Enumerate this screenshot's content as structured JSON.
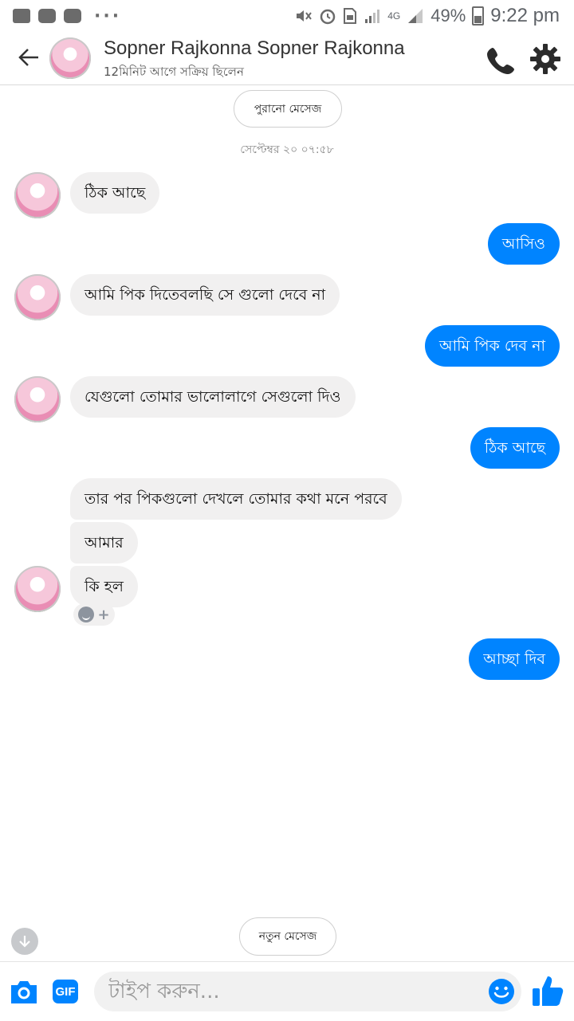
{
  "status_bar": {
    "battery": "49%",
    "time": "9:22 pm",
    "network": "4G",
    "dots": "···"
  },
  "header": {
    "contact_name": "Sopner Rajkonna Sopner Rajkonna",
    "active_status": "12মিনিট আগে সক্রিয় ছিলেন"
  },
  "older_messages_label": "পুরানো মেসেজ",
  "timestamp": "সেপ্টেম্বর ২০ ০৭:৫৮",
  "messages": [
    {
      "dir": "in",
      "text": "ঠিক আছে"
    },
    {
      "dir": "out",
      "text": "আসিও"
    },
    {
      "dir": "in",
      "text": "আমি পিক দিতেবলছি সে গুলো দেবে না"
    },
    {
      "dir": "out",
      "text": "আমি পিক দেব না"
    },
    {
      "dir": "in",
      "text": "যেগুলো তোমার ভালোলাগে সেগুলো দিও"
    },
    {
      "dir": "out",
      "text": "ঠিক আছে"
    },
    {
      "dir": "in",
      "text": "তার পর পিকগুলো দেখলে তোমার কথা মনে পরবে"
    },
    {
      "dir": "in",
      "text": "আমার"
    },
    {
      "dir": "in",
      "text": "কি হল"
    },
    {
      "dir": "out",
      "text": "আচ্ছা দিব"
    }
  ],
  "reaction_plus": "+",
  "new_messages_label": "নতুন মেসেজ",
  "composer": {
    "placeholder": "টাইপ করুন...",
    "gif_label": "GIF"
  },
  "colors": {
    "accent": "#0084ff",
    "incoming_bubble": "#f1f0f0"
  }
}
